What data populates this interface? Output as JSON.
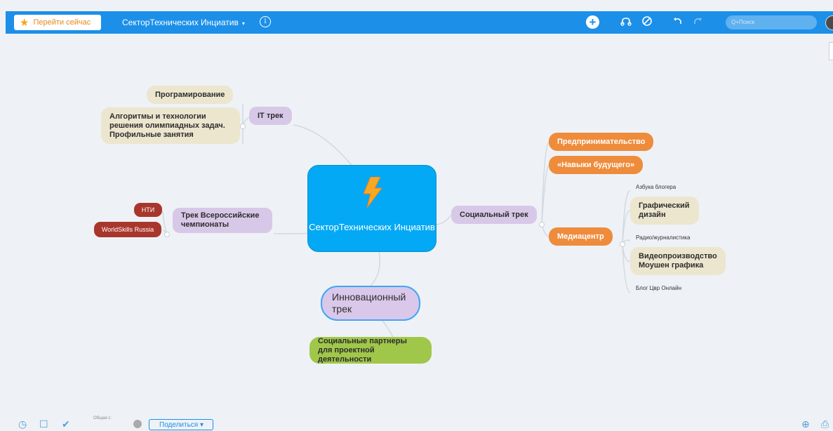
{
  "toolbar": {
    "go_now_label": "Перейти сейчас",
    "map_title": "СекторТехнических Инциатив",
    "title_caret": "▾",
    "info_glyph": "i",
    "add_glyph": "+",
    "search_placeholder": "Q+Поиск",
    "icons": [
      "star-icon",
      "info-icon",
      "add-icon",
      "structure-icon",
      "cancel-icon",
      "undo-icon",
      "redo-icon",
      "search-icon",
      "avatar"
    ]
  },
  "mindmap": {
    "central": "СекторТехнических Инциатив",
    "left": {
      "it_track": {
        "label": "IT трек",
        "children": [
          "Програмирование",
          "Алгоритмы и технологии решения олимпиадных задач. Профильные занятия"
        ]
      },
      "worldskills_track": {
        "label": "Трек Всероссийские чемпионаты",
        "children": [
          "НТИ",
          "WorldSkills Russia"
        ]
      }
    },
    "right": {
      "social_track": {
        "label": "Социальный трек",
        "children": [
          "Предпринимательство",
          "«Навыки будущего»",
          "Медиацентр"
        ]
      },
      "media_center_children": [
        "Азбука блогера",
        "Графический дизайн",
        "Радио/журналистика",
        "Видеопроизводство Моушен графика",
        "Блог Цвр Онлайн"
      ]
    },
    "bottom": {
      "innovation_track": "Инновационный трек",
      "partners": "Социальные партнеры для проектной деятельности"
    }
  },
  "bottombar": {
    "shared_with_label": "Общая с:",
    "share_button_label": "Поделиться ▾"
  },
  "colors": {
    "toolbar": "#1c8fe9",
    "canvas": "#eef2f6",
    "central": "#03a9f4",
    "orange": "#ee8c3c",
    "lilac": "#d8c8e8",
    "beige": "#ece6cf",
    "red": "#a8362c",
    "green": "#a0c74a"
  }
}
